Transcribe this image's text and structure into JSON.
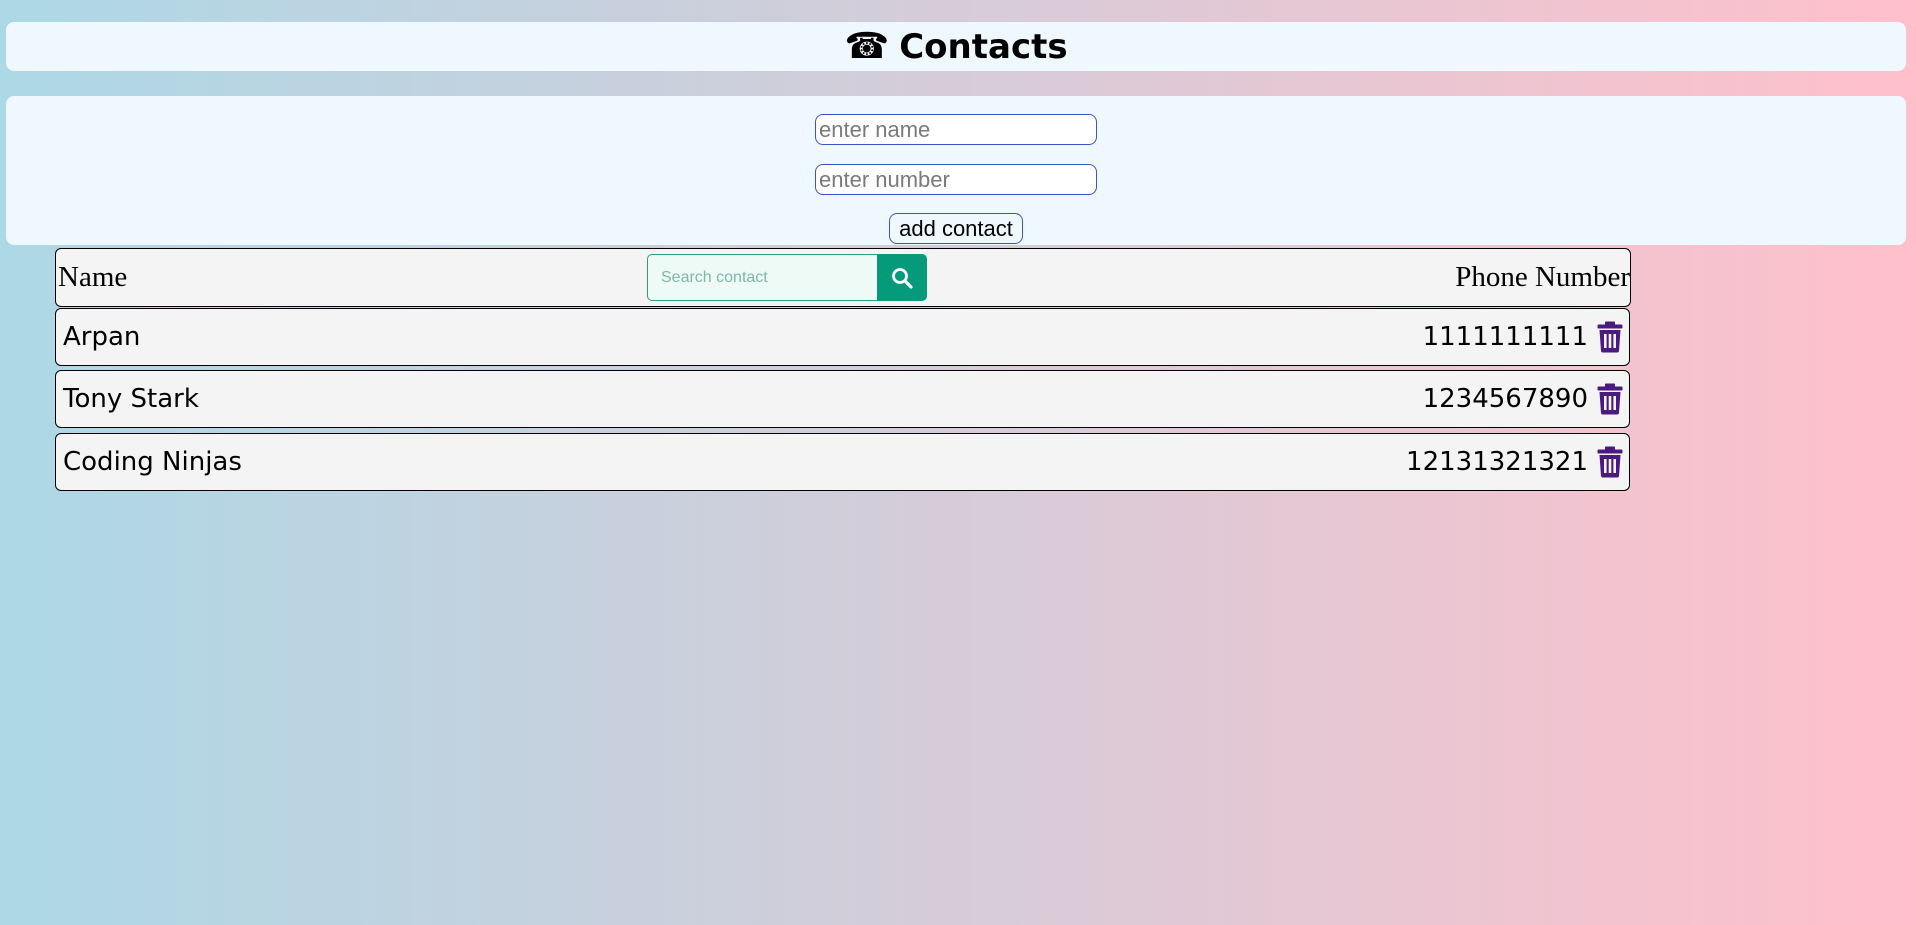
{
  "header": {
    "icon": "phone-icon",
    "icon_glyph": "☎",
    "title": "Contacts"
  },
  "form": {
    "name_placeholder": "enter name",
    "number_placeholder": "enter number",
    "name_value": "",
    "number_value": "",
    "add_button_label": "add contact"
  },
  "list": {
    "name_header": "Name",
    "phone_header": "Phone Number",
    "search_placeholder": "Search contact",
    "search_value": "",
    "search_icon": "search-icon",
    "delete_icon": "trash-icon",
    "contacts": [
      {
        "name": "Arpan",
        "phone": "1111111111"
      },
      {
        "name": "Tony Stark",
        "phone": "1234567890"
      },
      {
        "name": "Coding Ninjas",
        "phone": "12131321321"
      }
    ]
  },
  "colors": {
    "gradient_start": "#add8e6",
    "gradient_end": "#ffc0cb",
    "panel_bg": "#eff7ff",
    "input_border": "#3a54c9",
    "search_button": "#049a7a",
    "trash_icon": "#4b1a7e"
  }
}
